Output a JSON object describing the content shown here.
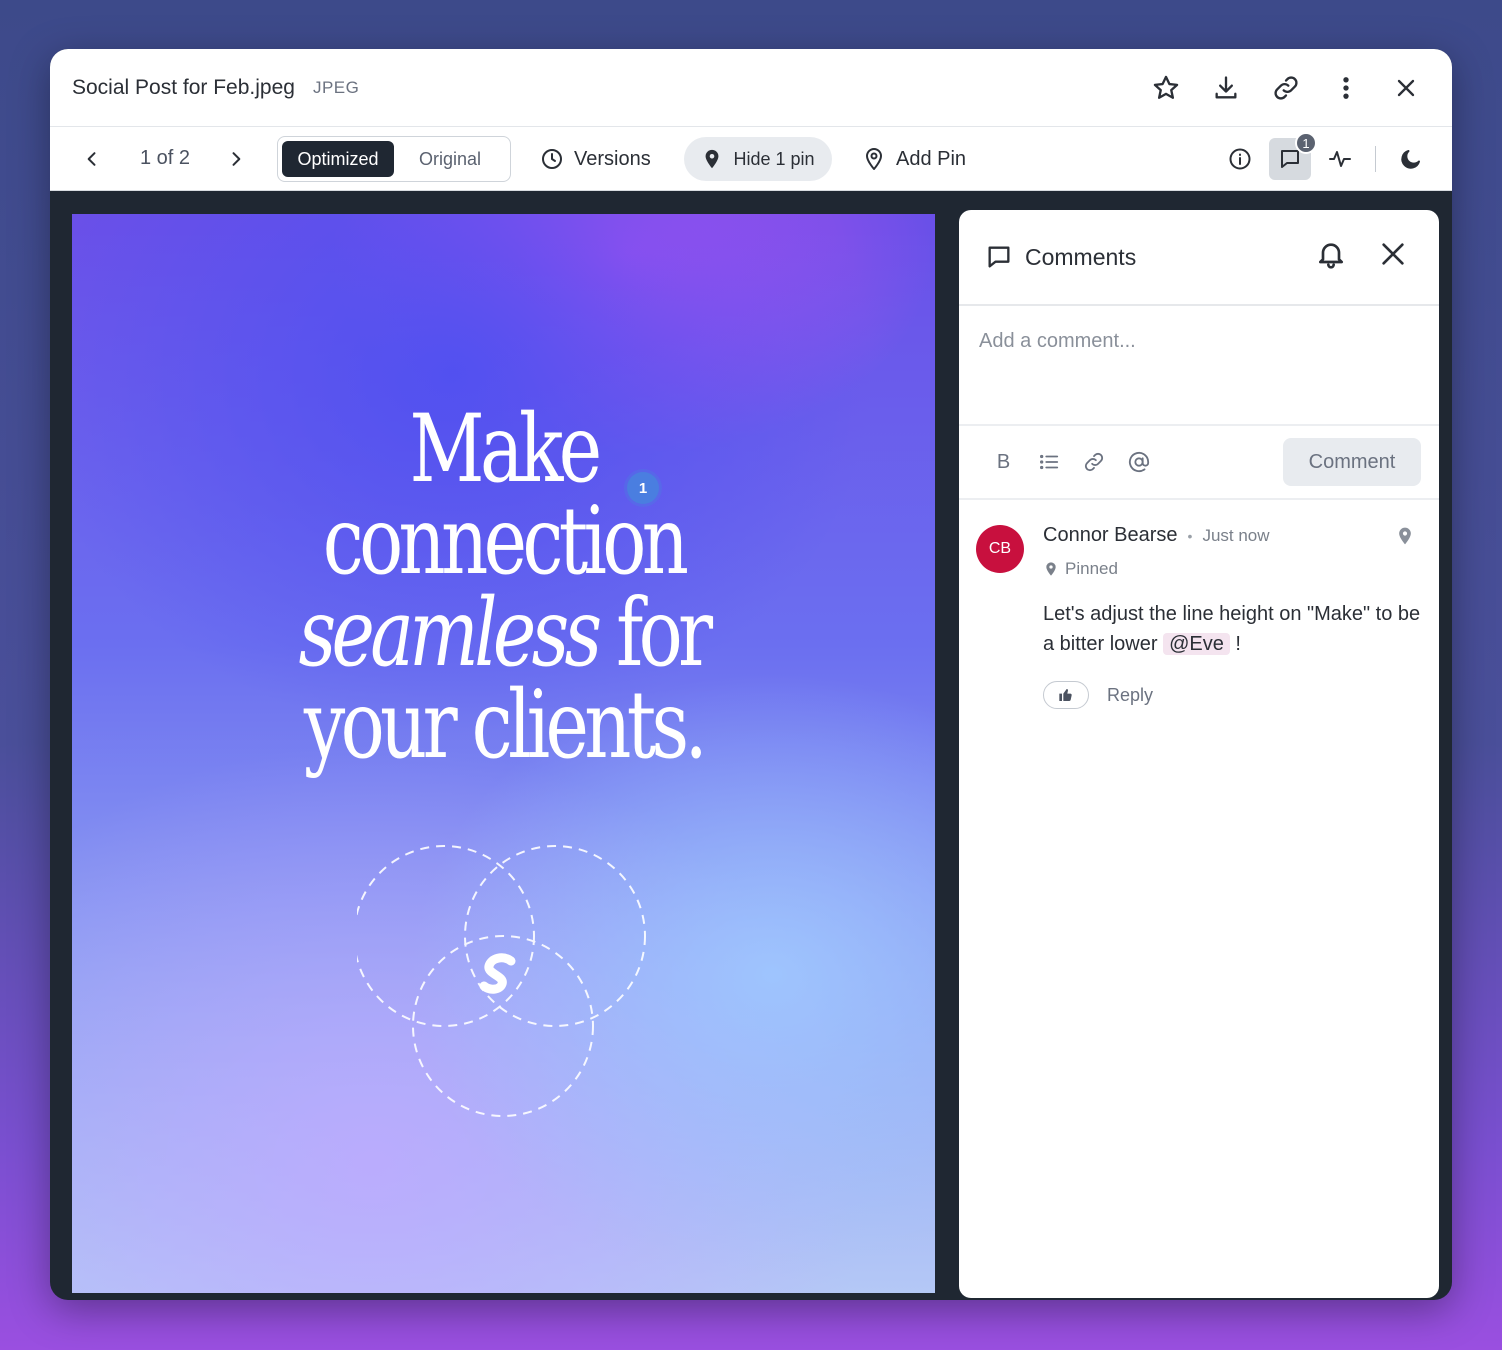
{
  "window": {
    "title": "Social Post for Feb.jpeg",
    "filetype": "JPEG"
  },
  "title_actions": [
    "star-icon",
    "download-icon",
    "link-icon",
    "more-vertical-icon",
    "close-icon"
  ],
  "toolbar": {
    "pager": "1 of 2",
    "view_modes": {
      "active": "Optimized",
      "inactive": "Original"
    },
    "versions_label": "Versions",
    "hide_pins_label": "Hide 1 pin",
    "add_pin_label": "Add Pin",
    "comments_badge": "1",
    "right_icons": [
      "info-icon",
      "comments-icon",
      "activity-icon",
      "dark-mode-icon"
    ]
  },
  "canvas": {
    "headline": {
      "line1": "Make",
      "line2": "connection",
      "line3_italic": "seamless",
      "line3_rest": "for",
      "line4": "your clients."
    },
    "pin_number": "1"
  },
  "comments_panel": {
    "title": "Comments",
    "input_placeholder": "Add a comment...",
    "format_tools": {
      "bold": "B"
    },
    "submit_label": "Comment",
    "items": [
      {
        "initials": "CB",
        "author": "Connor Bearse",
        "time": "Just now",
        "status": "Pinned",
        "text_before": "Let's adjust the line height on \"Make\" to be a bitter lower",
        "mention": "@Eve",
        "text_after": "!",
        "reply_label": "Reply",
        "avatar_color": "#c8103e"
      }
    ]
  }
}
